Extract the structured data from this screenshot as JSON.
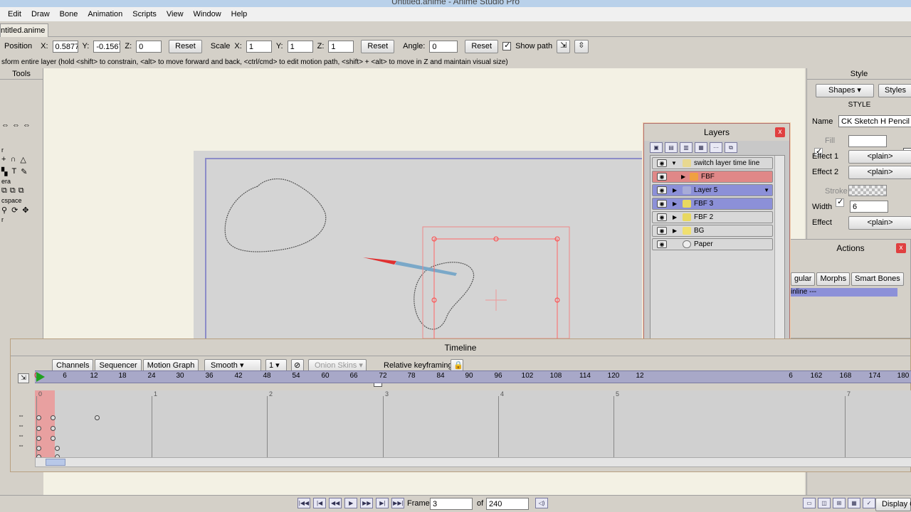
{
  "window": {
    "title": "Untitled.anime - Anime Studio Pro"
  },
  "menu": [
    "Edit",
    "Draw",
    "Bone",
    "Animation",
    "Scripts",
    "View",
    "Window",
    "Help"
  ],
  "document_tab": "ntitled.anime",
  "tool_options": {
    "position_label": "Position",
    "x_label": "X:",
    "x_value": "0.5877",
    "y_label": "Y:",
    "y_value": "-0.1567",
    "z_label": "Z:",
    "z_value": "0",
    "reset1": "Reset",
    "scale_label": "Scale",
    "sx_value": "1",
    "sy_value": "1",
    "sz_value": "1",
    "reset2": "Reset",
    "angle_label": "Angle:",
    "angle_value": "0",
    "reset3": "Reset",
    "show_path": "Show path"
  },
  "status_text": "sform entire layer (hold <shift> to constrain, <alt> to move forward and back, <ctrl/cmd> to edit motion path, <shift> + <alt> to move in Z and maintain visual size)",
  "tools": {
    "title": "Tools",
    "sections": [
      "r",
      "era",
      "cspace",
      "r"
    ]
  },
  "style_panel": {
    "title": "Style",
    "shapes_btn": "Shapes",
    "styles_btn": "Styles",
    "section": "STYLE",
    "name_label": "Name",
    "name_value": "CK Sketch H Pencil",
    "fill_label": "Fill",
    "effect1_label": "Effect 1",
    "effect1_value": "<plain>",
    "effect2_label": "Effect 2",
    "effect2_value": "<plain>",
    "stroke_label": "Stroke",
    "width_label": "Width",
    "width_value": "6",
    "effect_label": "Effect",
    "effect_value": "<plain>"
  },
  "layers": {
    "title": "Layers",
    "close": "x",
    "items": [
      {
        "name": "switch layer time line",
        "color": "#d8d8d8"
      },
      {
        "name": "FBF",
        "color": "#e08888"
      },
      {
        "name": "Layer 5",
        "color": "#8c90d8"
      },
      {
        "name": "FBF 3",
        "color": "#8c90d8"
      },
      {
        "name": "FBF 2",
        "color": "#d8d8d8"
      },
      {
        "name": "BG",
        "color": "#d8d8d8"
      },
      {
        "name": "Paper",
        "color": "#d8d8d8"
      }
    ]
  },
  "actions": {
    "title": "Actions",
    "close": "x",
    "tabs": [
      "gular",
      "Morphs",
      "Smart Bones"
    ],
    "item": "inline ---"
  },
  "timeline": {
    "title": "Timeline",
    "tabs": [
      "Channels",
      "Sequencer",
      "Motion Graph"
    ],
    "interp": "Smooth",
    "interp_num": "1",
    "onion": "Onion Skins",
    "relative_keyframing": "Relative keyframing",
    "ruler": [
      "0",
      "6",
      "12",
      "18",
      "24",
      "30",
      "36",
      "42",
      "48",
      "54",
      "60",
      "66",
      "72",
      "78",
      "84",
      "90",
      "96",
      "102",
      "108",
      "114",
      "120",
      "12",
      "6",
      "162",
      "168",
      "174",
      "180"
    ],
    "seconds": [
      "0",
      "1",
      "2",
      "3",
      "4",
      "5",
      "7"
    ]
  },
  "playback": {
    "frame_label": "Frame",
    "frame_value": "3",
    "of_label": "of",
    "total_value": "240",
    "display": "Display Q"
  }
}
